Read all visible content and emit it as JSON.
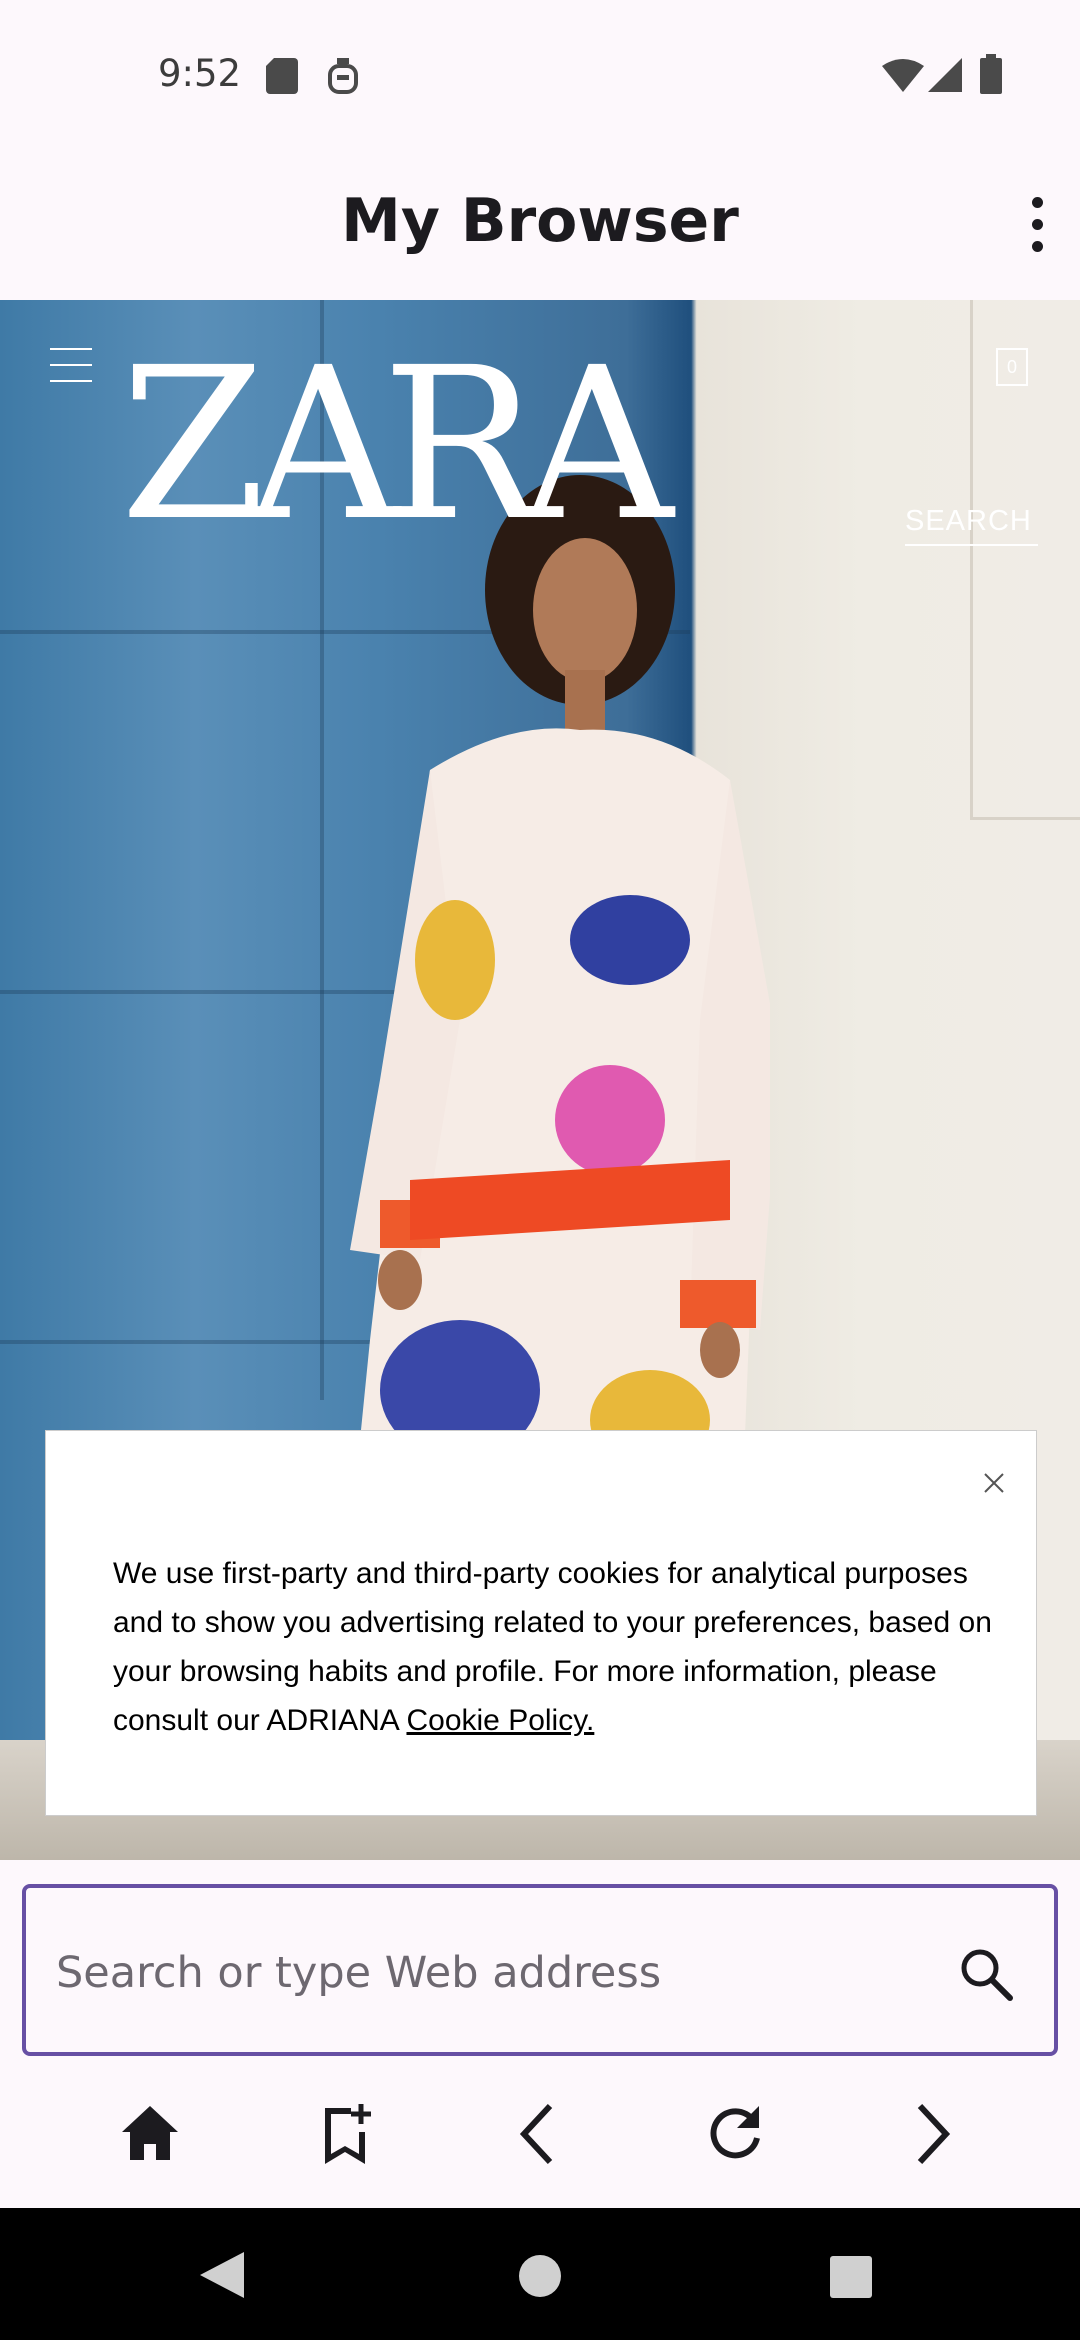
{
  "status_bar": {
    "time": "9:52",
    "left_icons": [
      "sd-card-icon",
      "assistant-icon"
    ],
    "right_icons": [
      "wifi-icon",
      "cell-signal-icon",
      "battery-icon"
    ]
  },
  "app_bar": {
    "title": "My Browser",
    "menu_icon": "more-vert-icon"
  },
  "webpage": {
    "brand_logo": "ZARA",
    "bag_count": "0",
    "search_link": "SEARCH",
    "cookie_banner": {
      "text": "We use first-party and third-party cookies for analytical purposes and to show you advertising related to your preferences, based on your browsing habits and profile. For more information, please consult our ADRIANA ",
      "link_label": "Cookie Policy."
    }
  },
  "address_bar": {
    "placeholder": "Search or type Web address",
    "value": ""
  },
  "toolbar": {
    "buttons": [
      "home-icon",
      "bookmark-add-icon",
      "back-icon",
      "reload-icon",
      "forward-icon"
    ]
  },
  "colors": {
    "accent": "#6750a4",
    "background": "#fdf8fc",
    "nav_bar": "#000000"
  }
}
